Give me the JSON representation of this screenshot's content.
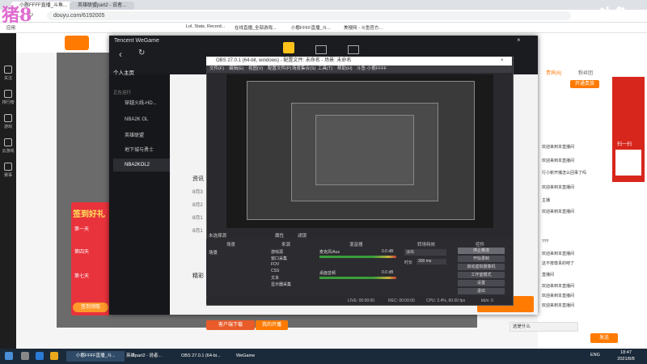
{
  "browser": {
    "tabs": [
      "小憨FFFF直播_斗鱼...",
      "英雄联盟part2 - 说者..."
    ],
    "url": "douyu.com/6192005",
    "bookmarks": [
      "应用",
      "Lol, Stats, Record...",
      "在线直播_全部游戏...",
      "小憨FFFF直播_斗...",
      "美搜网 - 斗鱼官方..."
    ]
  },
  "watermark": {
    "left": "猪8",
    "right": "斗鱼"
  },
  "douyu": {
    "left_nav": [
      "关注",
      "排行榜",
      "游戏",
      "云游戏",
      "赛事"
    ],
    "right_tabs": [
      "贵宾(6)",
      "粉丝团"
    ],
    "open_noble": "开通贵族",
    "chat": [
      "欢迎来到本直播间",
      "欢迎来到本直播间",
      "行小新开播怎么回事了吗",
      "欢迎来到本直播间",
      "主播",
      "欢迎来到本直播间",
      "???",
      "欢迎来到本直播间",
      "这不按尊贵的吧了",
      "直播间",
      "欢迎来到本直播间",
      "欢迎来到本直播间",
      "欢迎来到本直播间",
      "这是什么"
    ],
    "promo_banner": "签到好礼",
    "promo_days": [
      "第一天",
      "第四天",
      "第七天"
    ],
    "promo_button": "签到领取",
    "bottom_links": [
      "客户端下载",
      "我的开播"
    ],
    "chat_input_hint": "这是什么",
    "send": "发送",
    "qr_caption": "扫一扫"
  },
  "wegame": {
    "title": "Tencent WeGame",
    "user": "个人主页",
    "section": "正在运行",
    "games": [
      "穿越火线-HD...",
      "NBA2K OL",
      "英雄联盟",
      "地下城与勇士",
      "NBA2KOL2"
    ],
    "news_label": "资讯",
    "news_dates": [
      "8月3",
      "8月2",
      "8月1",
      "8月1"
    ],
    "recommend_label": "精彩",
    "start_label": "开始游戏"
  },
  "obs": {
    "title": "OBS 27.0.1 (64-bit, windows) - 配置文件: 未命名 - 场景: 未命名",
    "menu": [
      "文件(F)",
      "编辑(E)",
      "视图(V)",
      "配置文件(P)",
      "场景集合(S)",
      "工具(T)",
      "帮助(H)",
      "斗鱼·小憨FFFF"
    ],
    "no_source": "未选择源",
    "props": "属性",
    "filters": "滤镜",
    "docks": [
      "场景",
      "来源",
      "混音器",
      "转场特效",
      "控件"
    ],
    "scene": "场景",
    "sources": [
      "游戏源",
      "窗口采集",
      "FOV",
      "CSS",
      "文本",
      "显示器采集"
    ],
    "mixer": [
      {
        "name": "麦克风/Aux",
        "level": "0.0 dB"
      },
      {
        "name": "桌面音频",
        "level": "0.0 dB"
      }
    ],
    "transition": "淡出",
    "duration_label": "时长",
    "duration": "300 ms",
    "controls": [
      "停止推流",
      "开始录制",
      "启动虚拟摄像机",
      "工作室模式",
      "设置",
      "退出"
    ],
    "status": {
      "live": "LIVE: 00:00:00",
      "rec": "REC: 00:00:00",
      "cpu": "CPU: 2.4%, 60.00 fps"
    },
    "bitrate": "kb/s: 0"
  },
  "taskbar": {
    "items": [
      "小憨FFFF直播_斗...",
      "英雄part2 - 说者...",
      "OBS 27.0.1 (64-bi...",
      "WeGame"
    ],
    "time": "18:47",
    "date": "2021/8/8",
    "lang": "ENG"
  }
}
